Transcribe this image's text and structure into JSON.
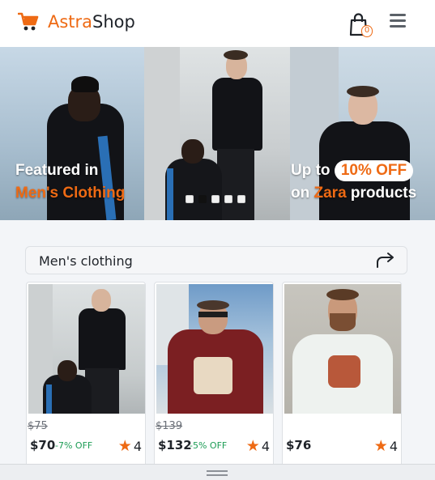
{
  "header": {
    "logo_part1": "Astra",
    "logo_part2": "Shop",
    "logo_icon": "cart-icon",
    "cart_count": "0",
    "cart_icon": "shopping-bag-icon",
    "menu_icon": "hamburger-menu-icon"
  },
  "banner": {
    "slide1_line1": "Featured in",
    "slide1_line2": "Men's Clothing",
    "slide3_line1_pre": "Up to",
    "slide3_highlight": "10% OFF",
    "slide3_line2_pre": "on",
    "slide3_brand": "Zara",
    "slide3_line2_post": "products",
    "dots_total": 5,
    "dots_active_index": 1
  },
  "category": {
    "label": "Men's clothing",
    "share_icon": "share-arrow-icon"
  },
  "products": [
    {
      "old_price": "$75",
      "price": "$70",
      "discount": "-7% OFF",
      "rating": "4"
    },
    {
      "old_price": "$139",
      "price": "$132",
      "discount": "-5% OFF",
      "rating": "4"
    },
    {
      "old_price": "",
      "price": "$76",
      "discount": "",
      "rating": "4"
    }
  ],
  "colors": {
    "accent": "#ee6a14",
    "discount_green": "#1c9c55",
    "page_bg": "#f3f5f8"
  }
}
